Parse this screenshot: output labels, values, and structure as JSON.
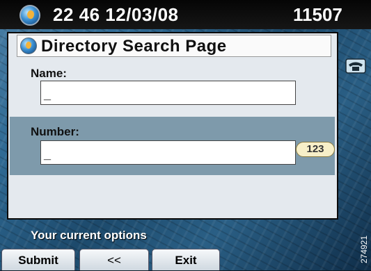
{
  "status_bar": {
    "datetime": "22 46 12/03/08",
    "extension": "11507"
  },
  "window": {
    "title": "Directory Search Page"
  },
  "form": {
    "name_label": "Name:",
    "name_value": "_",
    "number_label": "Number:",
    "number_value": "_",
    "number_mode": "123"
  },
  "footer": {
    "options_label": "Your current options",
    "softkeys": [
      "Submit",
      "<<",
      "Exit"
    ]
  },
  "side_code": "274921"
}
